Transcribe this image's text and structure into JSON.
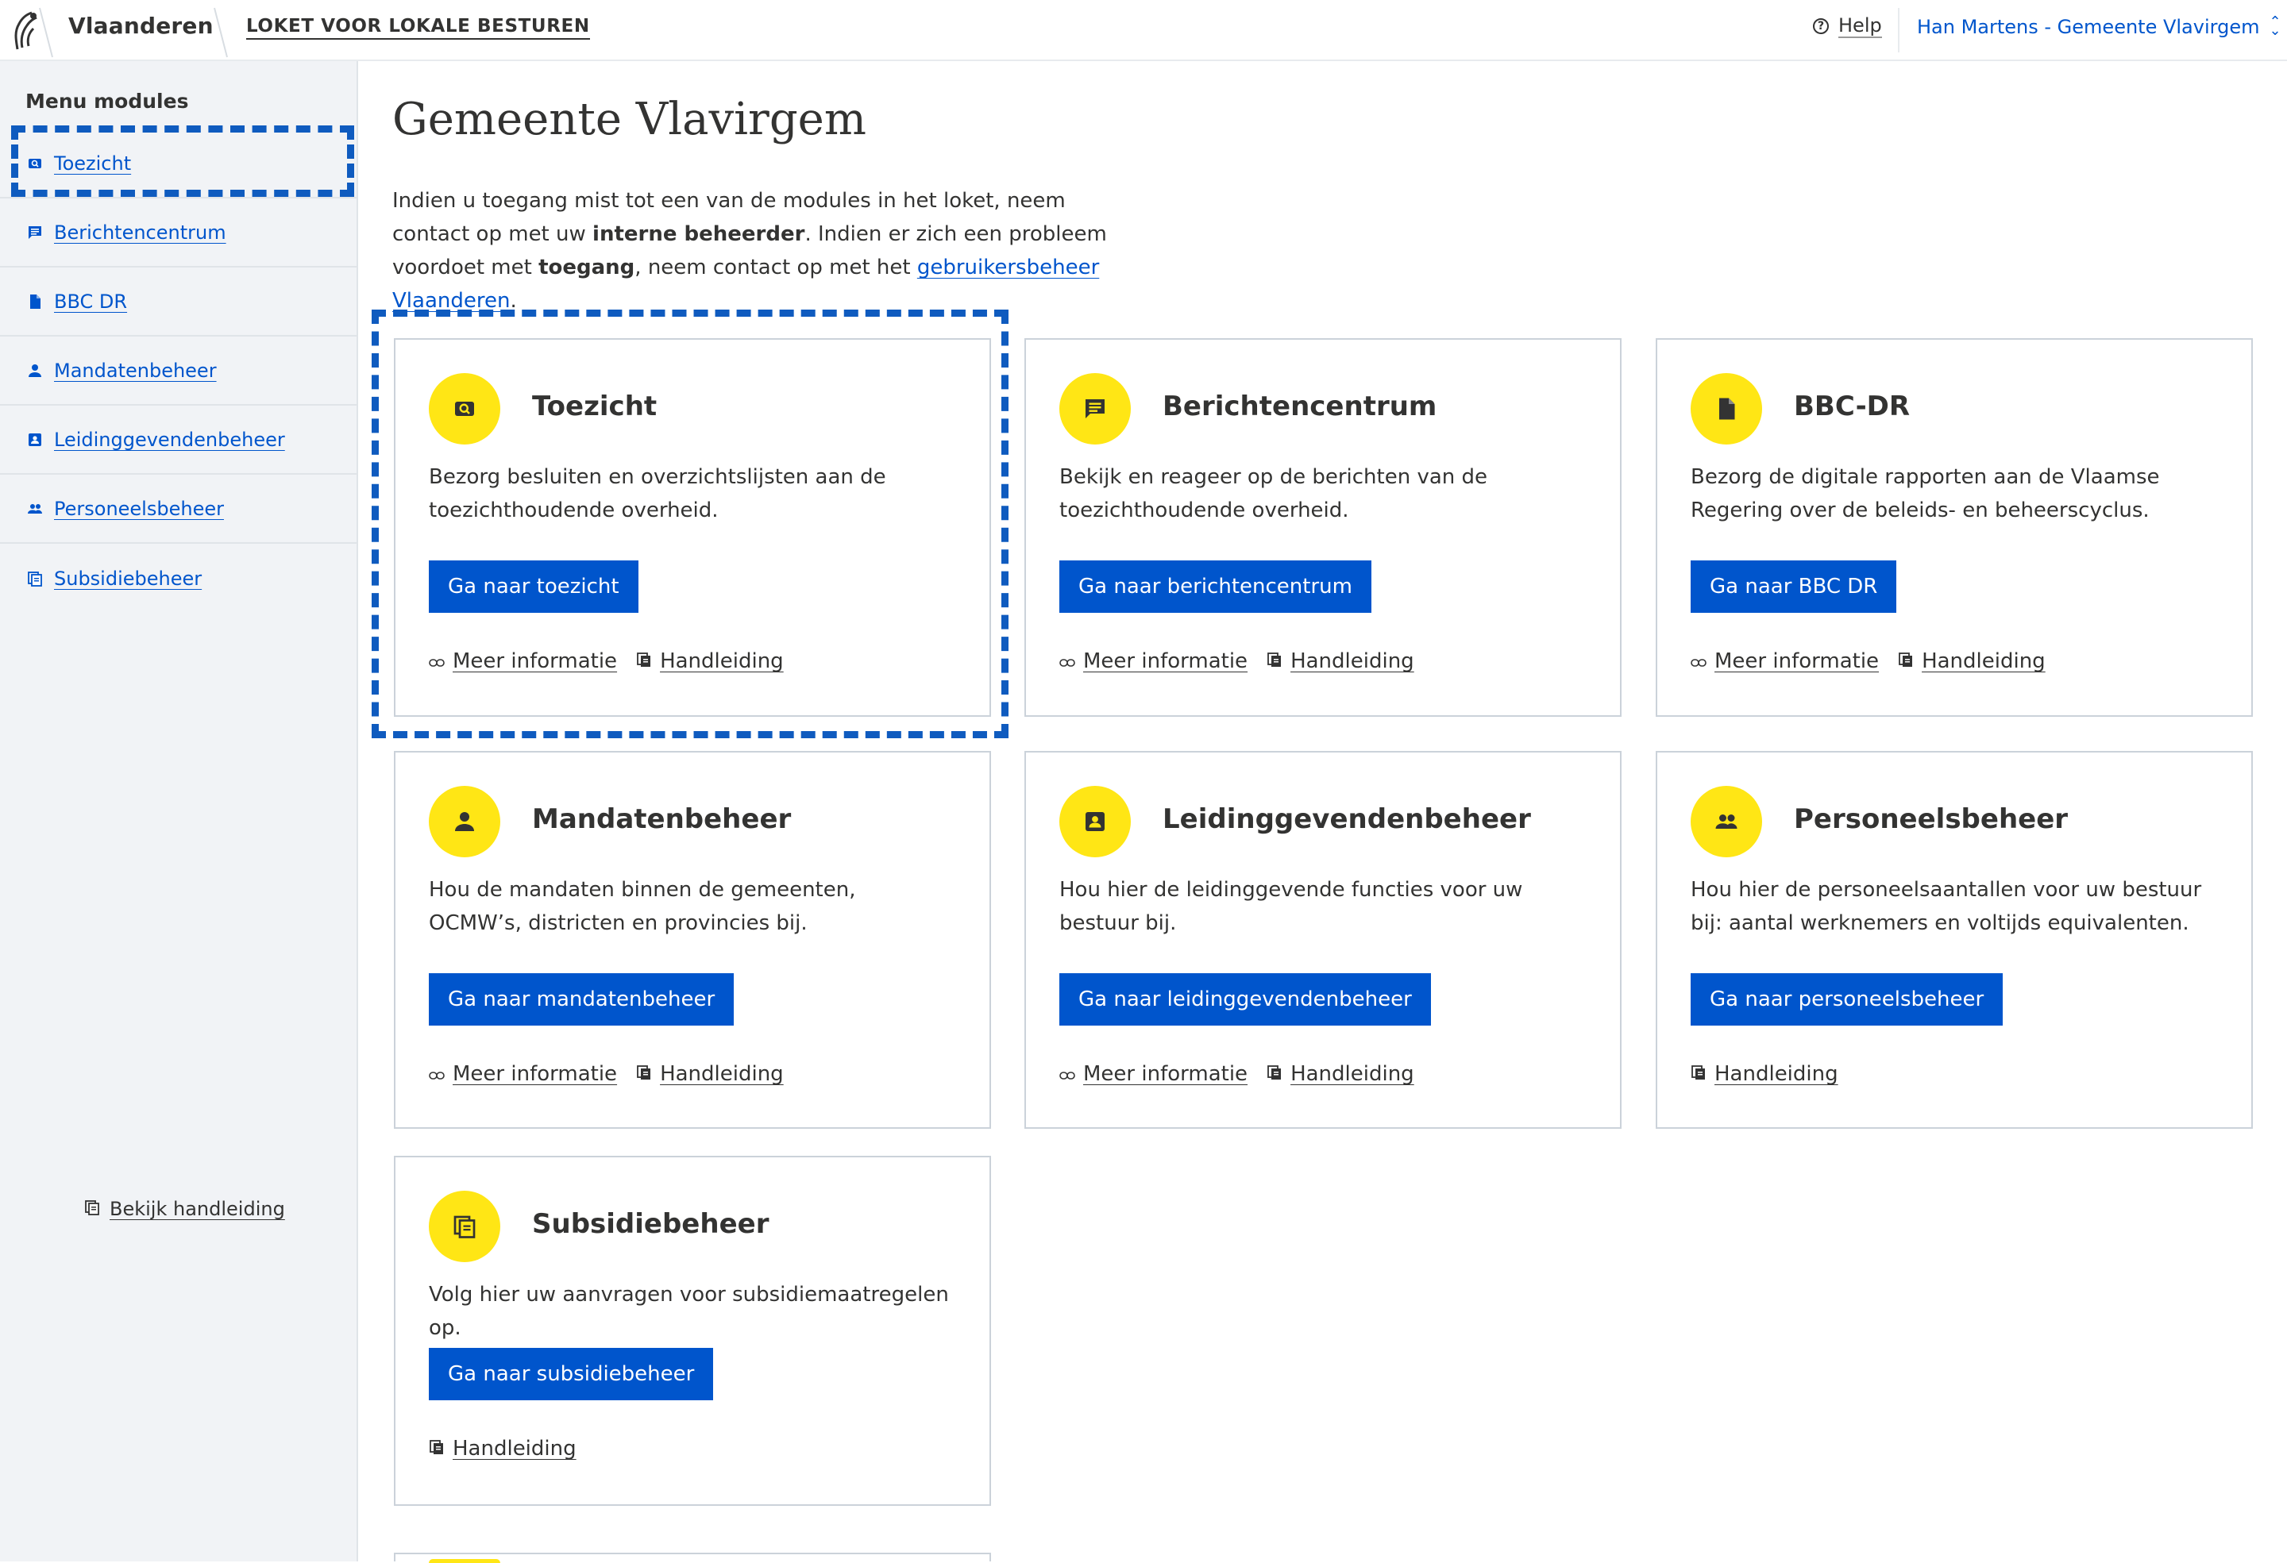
{
  "header": {
    "brand": "Vlaanderen",
    "app_title": "LOKET VOOR LOKALE BESTUREN",
    "help_label": "Help",
    "user_label": "Han Martens - Gemeente Vlavirgem"
  },
  "sidebar": {
    "title": "Menu modules",
    "items": [
      {
        "label": "Toezicht",
        "icon": "toezicht-icon"
      },
      {
        "label": "Berichtencentrum",
        "icon": "message-icon"
      },
      {
        "label": "BBC DR",
        "icon": "document-icon"
      },
      {
        "label": "Mandatenbeheer",
        "icon": "person-icon"
      },
      {
        "label": "Leidinggevendenbeheer",
        "icon": "badge-icon"
      },
      {
        "label": "Personeelsbeheer",
        "icon": "people-icon"
      },
      {
        "label": "Subsidiebeheer",
        "icon": "copy-icon"
      }
    ],
    "help_link": "Bekijk handleiding"
  },
  "main": {
    "title": "Gemeente Vlavirgem",
    "intro": {
      "part1": "Indien u toegang mist tot een van de modules in het loket, neem contact op met uw ",
      "bold1": "interne beheerder",
      "part2": ". Indien er zich een probleem voordoet met ",
      "bold2": "toegang",
      "part3": ", neem contact op met het ",
      "link": "gebruikersbeheer Vlaanderen",
      "part4": "."
    },
    "more_info_label": "Meer informatie",
    "manual_label": "Handleiding",
    "cards": [
      {
        "title": "Toezicht",
        "description": "Bezorg besluiten en overzichtslijsten aan de toezichthoudende overheid.",
        "button": "Ga naar toezicht",
        "icon": "toezicht-icon"
      },
      {
        "title": "Berichtencentrum",
        "description": "Bekijk en reageer op de berichten van de toezichthoudende overheid.",
        "button": "Ga naar berichtencentrum",
        "icon": "message-icon"
      },
      {
        "title": "BBC-DR",
        "description": "Bezorg de digitale rapporten aan de Vlaamse Regering over de beleids- en beheerscyclus.",
        "button": "Ga naar BBC DR",
        "icon": "document-icon"
      },
      {
        "title": "Mandatenbeheer",
        "description": "Hou de mandaten binnen de gemeenten, OCMW’s, districten en provincies bij.",
        "button": "Ga naar mandatenbeheer",
        "icon": "person-icon"
      },
      {
        "title": "Leidinggevendenbeheer",
        "description": "Hou hier de leidinggevende functies voor uw bestuur bij.",
        "button": "Ga naar leidinggevendenbeheer",
        "icon": "badge-icon"
      },
      {
        "title": "Personeelsbeheer",
        "description": "Hou hier de personeelsaantallen voor uw bestuur bij: aantal werknemers en voltijds equivalenten.",
        "button": "Ga naar personeelsbeheer",
        "icon": "people-icon"
      },
      {
        "title": "Subsidiebeheer",
        "description": "Volg hier uw aanvragen voor subsidiemaatregelen op.",
        "button": "Ga naar subsidiebeheer",
        "icon": "copy-icon"
      }
    ]
  },
  "colors": {
    "primary": "#0055cc",
    "accent_yellow": "#ffe615",
    "sidebar_bg": "#f1f3f6",
    "highlight": "#0f5bbf"
  }
}
